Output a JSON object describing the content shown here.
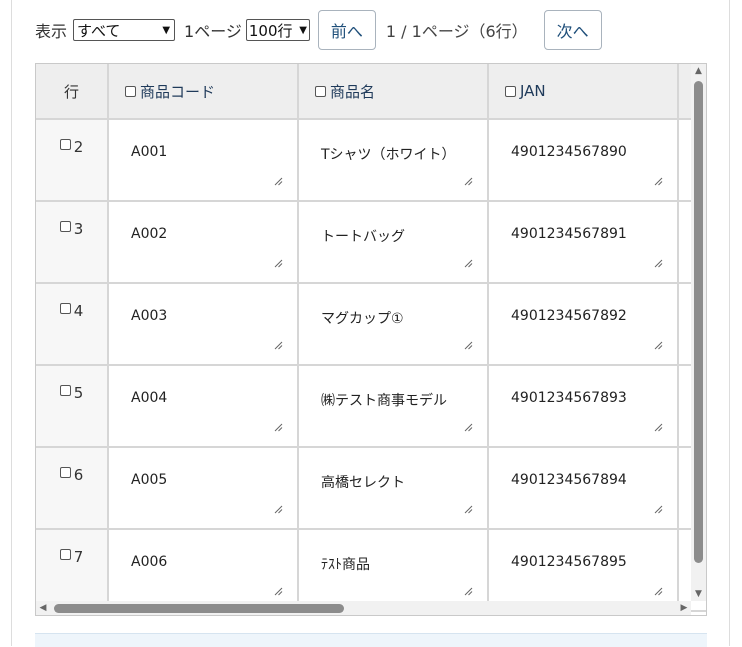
{
  "toolbar": {
    "display_label": "表示",
    "filter_value": "すべて",
    "per_page_label": "1ページ",
    "rows_value": "100行",
    "prev_label": "前へ",
    "page_info": "1 / 1ページ（6行）",
    "next_label": "次へ"
  },
  "grid": {
    "row_header": "行",
    "columns": [
      "商品コード",
      "商品名",
      "JAN"
    ],
    "rows": [
      {
        "num": "2",
        "cells": [
          "A001",
          "Tシャツ（ホワイト）",
          "4901234567890"
        ]
      },
      {
        "num": "3",
        "cells": [
          "A002",
          "トートバッグ",
          "4901234567891"
        ]
      },
      {
        "num": "4",
        "cells": [
          "A003",
          "マグカップ①",
          "4901234567892"
        ]
      },
      {
        "num": "5",
        "cells": [
          "A004",
          "㈱テスト商事モデル",
          "4901234567893"
        ]
      },
      {
        "num": "6",
        "cells": [
          "A005",
          "高橋セレクト",
          "4901234567894"
        ]
      },
      {
        "num": "7",
        "cells": [
          "A006",
          "ﾃｽﾄ商品",
          "4901234567895"
        ]
      }
    ]
  },
  "icons": {
    "checkbox": "checkbox-icon",
    "resize": "resize-grip-icon",
    "arrow_up": "arrow-up-icon",
    "arrow_down": "arrow-down-icon",
    "arrow_left": "arrow-left-icon",
    "arrow_right": "arrow-right-icon"
  }
}
